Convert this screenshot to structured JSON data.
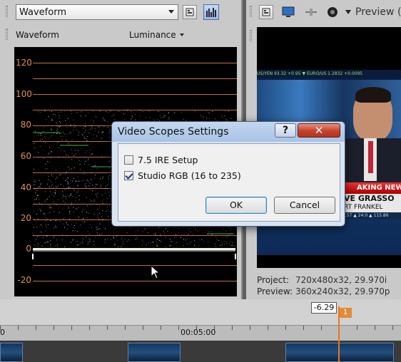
{
  "scopes_toolbar": {
    "scope_type": "Waveform"
  },
  "scopes_header": {
    "scope_label": "Waveform",
    "mode_label": "Luminance"
  },
  "scope": {
    "ire_labels": [
      "120",
      "100",
      "80",
      "60",
      "40",
      "20",
      "0",
      "-20"
    ]
  },
  "preview_toolbar": {
    "label": "Preview (A"
  },
  "preview_info": {
    "project_label": "Project:",
    "project_value": "720x480x32, 29.970i",
    "preview_label": "Preview:",
    "preview_value": "360x240x32, 29.970p"
  },
  "video_frame": {
    "ticker": "US/YEN 93.32 +0.95 ▼ EURO/US 1.2832 +0.0095",
    "breaking": "AKING NEWS",
    "name": "VE GRASSO",
    "name2": "RT FRANKEL",
    "bottom_ticker": "3.57 ▲ 24.0 ▲ 115.86"
  },
  "timeline": {
    "cursor_time": "-6.29",
    "marker_label": "1",
    "ruler_start": "0",
    "ruler_time": "00:05:00"
  },
  "dialog": {
    "title": "Video Scopes Settings",
    "help_label": "?",
    "close_label": "✕",
    "option1_label": "7.5 IRE Setup",
    "option1_checked": false,
    "option2_label": "Studio RGB (16 to 235)",
    "option2_checked": true,
    "ok_label": "OK",
    "cancel_label": "Cancel"
  }
}
